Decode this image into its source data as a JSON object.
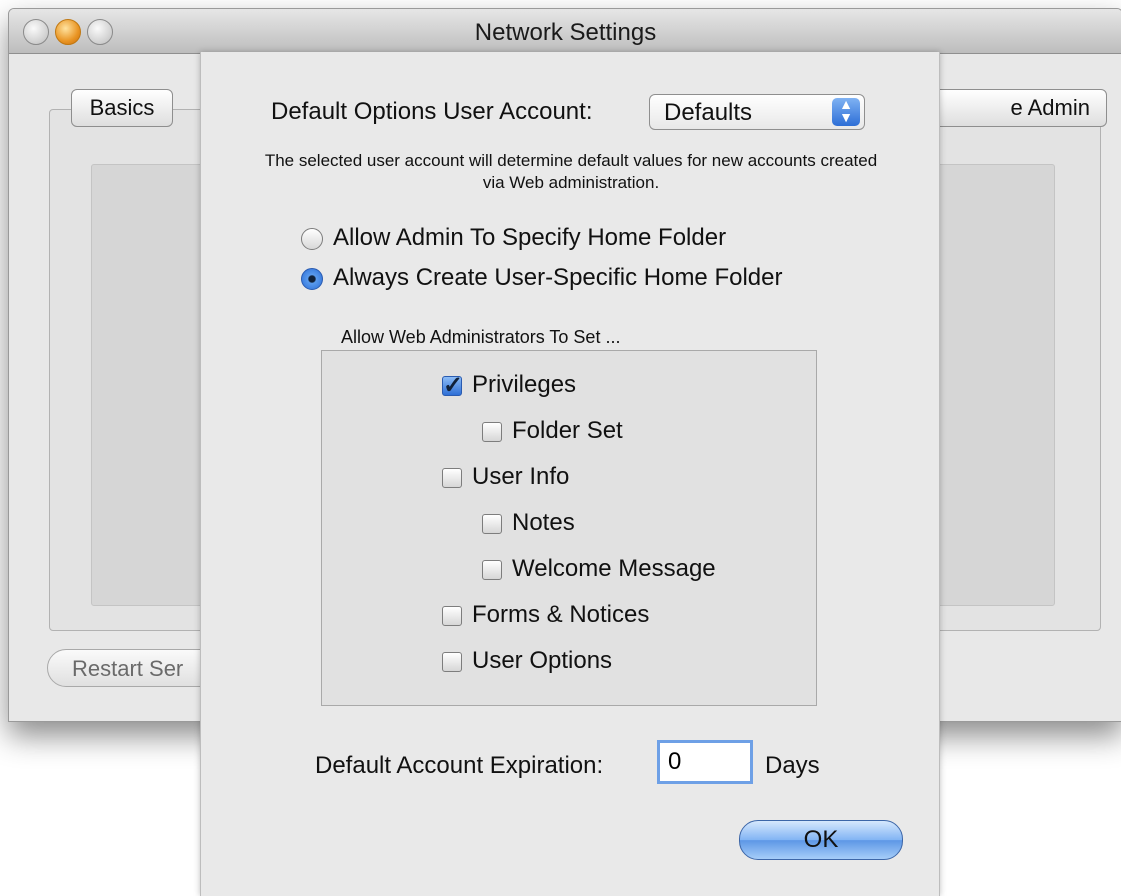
{
  "window": {
    "title": "Network Settings",
    "tabs": {
      "basics": "Basics",
      "remote_admin_partial": "e Admin"
    },
    "restart_label": "Restart Ser"
  },
  "sheet": {
    "account_label": "Default Options User Account:",
    "account_value": "Defaults",
    "description": "The selected user account will determine default values for new accounts created via Web administration.",
    "radios": [
      {
        "label": "Allow Admin To Specify Home Folder",
        "selected": false
      },
      {
        "label": "Always Create User-Specific Home Folder",
        "selected": true
      }
    ],
    "group_title": "Allow Web Administrators To Set ...",
    "checkboxes": [
      {
        "label": "Privileges",
        "checked": true
      },
      {
        "label": "Folder Set",
        "checked": false
      },
      {
        "label": "User Info",
        "checked": false
      },
      {
        "label": "Notes",
        "checked": false
      },
      {
        "label": "Welcome Message",
        "checked": false
      },
      {
        "label": "Forms & Notices",
        "checked": false
      },
      {
        "label": "User Options",
        "checked": false
      }
    ],
    "expiration_label": "Default Account Expiration:",
    "expiration_value": "0",
    "expiration_unit": "Days",
    "ok_label": "OK"
  },
  "colors": {
    "accent": "#2a6cd5",
    "window_bg": "#e8e8e8",
    "sheet_bg": "#e9e9e9"
  }
}
